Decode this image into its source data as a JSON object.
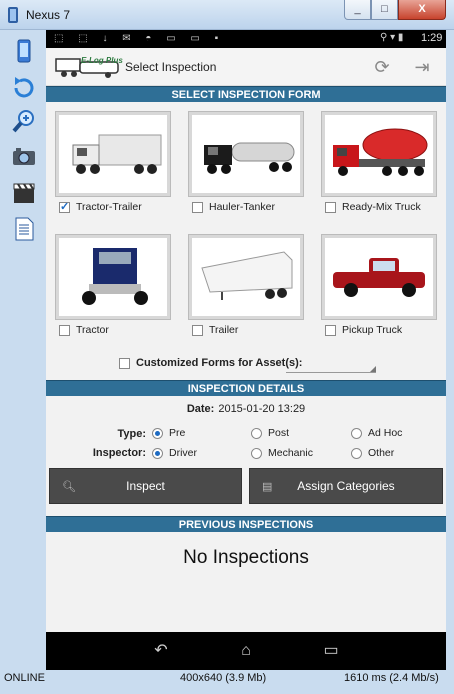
{
  "window": {
    "title": "Nexus 7",
    "minimize": "_",
    "maximize": "□",
    "close": "X"
  },
  "toolstrip": [
    "device-icon",
    "rotate-icon",
    "zoom-icon",
    "camera-icon",
    "clapper-icon",
    "document-icon"
  ],
  "statusbar": {
    "time": "1:29"
  },
  "actionbar": {
    "logo_text": "E-Log Plus",
    "title": "Select Inspection"
  },
  "select_form": {
    "header": "SELECT INSPECTION FORM",
    "options": [
      {
        "label": "Tractor-Trailer",
        "checked": true
      },
      {
        "label": "Hauler-Tanker",
        "checked": false
      },
      {
        "label": "Ready-Mix Truck",
        "checked": false
      },
      {
        "label": "Tractor",
        "checked": false
      },
      {
        "label": "Trailer",
        "checked": false
      },
      {
        "label": "Pickup Truck",
        "checked": false
      }
    ],
    "customized_label": "Customized Forms for Asset(s):"
  },
  "details": {
    "header": "INSPECTION DETAILS",
    "date_label": "Date:",
    "date_value": "2015-01-20 13:29",
    "type_label": "Type:",
    "type_options": [
      "Pre",
      "Post",
      "Ad Hoc"
    ],
    "inspector_label": "Inspector:",
    "inspector_options": [
      "Driver",
      "Mechanic",
      "Other"
    ],
    "inspect_button": "Inspect",
    "assign_button": "Assign Categories"
  },
  "previous": {
    "header": "PREVIOUS INSPECTIONS",
    "empty_text": "No Inspections"
  },
  "emulator_status": {
    "state": "ONLINE",
    "resolution": "400x640 (3.9 Mb)",
    "timing": "1610 ms (2.4 Mb/s)"
  }
}
